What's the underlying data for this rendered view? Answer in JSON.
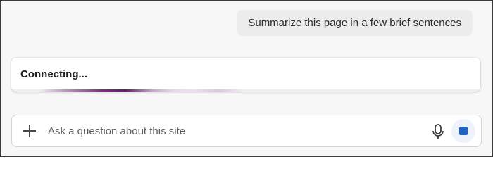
{
  "conversation": {
    "user_message": "Summarize this page in a few brief sentences"
  },
  "status": {
    "text": "Connecting..."
  },
  "composer": {
    "placeholder": "Ask a question about this site",
    "add_icon": "plus-icon",
    "mic_icon": "microphone-icon",
    "stop_icon": "stop-square-icon"
  },
  "colors": {
    "accent": "#1f64c0",
    "progress": "#6a1470"
  }
}
